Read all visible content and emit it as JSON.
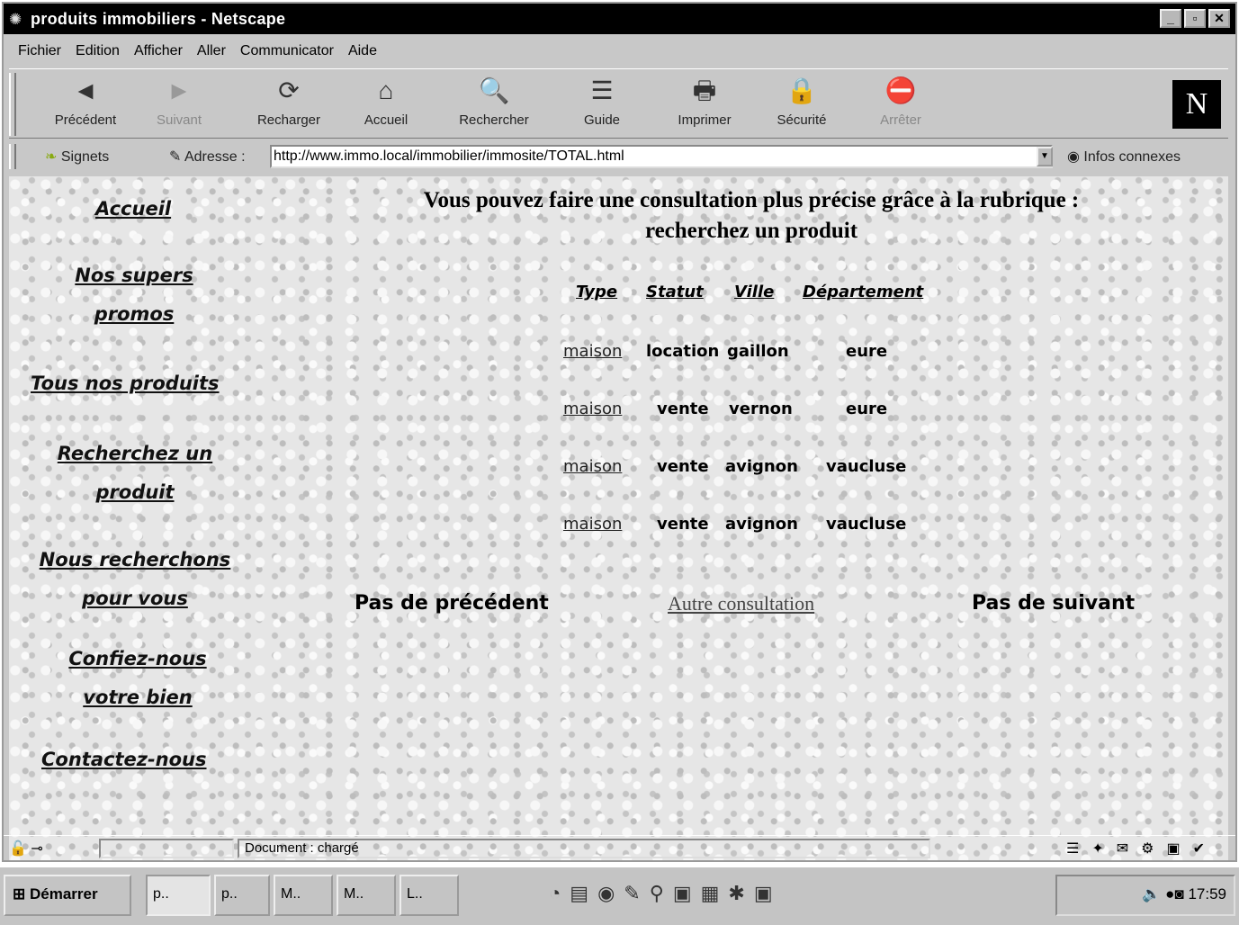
{
  "window": {
    "title": "produits immobiliers - Netscape",
    "controls": [
      "_",
      "▫",
      "✕"
    ]
  },
  "menu": [
    "Fichier",
    "Edition",
    "Afficher",
    "Aller",
    "Communicator",
    "Aide"
  ],
  "toolbar": {
    "buttons": [
      {
        "label": "Précédent",
        "icon": "back-icon",
        "glyph": "◄",
        "enabled": true
      },
      {
        "label": "Suivant",
        "icon": "forward-icon",
        "glyph": "►",
        "enabled": false
      },
      {
        "label": "Recharger",
        "icon": "reload-icon",
        "glyph": "⟳",
        "enabled": true
      },
      {
        "label": "Accueil",
        "icon": "home-icon",
        "glyph": "⌂",
        "enabled": true
      },
      {
        "label": "Rechercher",
        "icon": "search-icon",
        "glyph": "🔍",
        "enabled": true
      },
      {
        "label": "Guide",
        "icon": "guide-icon",
        "glyph": "☰",
        "enabled": true
      },
      {
        "label": "Imprimer",
        "icon": "print-icon",
        "glyph": "🖶",
        "enabled": true
      },
      {
        "label": "Sécurité",
        "icon": "lock-icon",
        "glyph": "🔒",
        "enabled": true
      },
      {
        "label": "Arrêter",
        "icon": "stop-icon",
        "glyph": "⛔",
        "enabled": false
      }
    ],
    "logo": "N"
  },
  "location": {
    "bookmarks_label": "Signets",
    "address_label": "Adresse :",
    "url": "http://www.immo.local/immobilier/immosite/TOTAL.html",
    "related_label": "Infos connexes"
  },
  "nav": {
    "accueil": "Accueil",
    "promos_1": "Nos supers",
    "promos_2": "promos",
    "produits": "Tous nos produits",
    "recherche_1": "Recherchez un",
    "recherche_2": "produit",
    "nous_1": "Nous recherchons",
    "nous_2": "pour vous",
    "confiez_1": "Confiez-nous",
    "confiez_2": "votre bien",
    "contact": "Contactez-nous"
  },
  "main": {
    "headline_1": "Vous pouvez faire une consultation plus précise grâce à la rubrique :",
    "headline_2": "recherchez un produit",
    "columns": [
      "Type",
      "Statut",
      "Ville",
      "Département"
    ],
    "rows": [
      [
        "maison",
        "location",
        "gaillon",
        "eure"
      ],
      [
        "maison",
        "vente",
        "vernon",
        "eure"
      ],
      [
        "maison",
        "vente",
        "avignon",
        "vaucluse"
      ],
      [
        "maison",
        "vente",
        "avignon",
        "vaucluse"
      ]
    ],
    "prev": "Pas de précédent",
    "other": "Autre consultation",
    "next": "Pas de suivant"
  },
  "status": {
    "text": "Document : chargé"
  },
  "taskbar": {
    "start": "Démarrer",
    "tasks": [
      "p..",
      "p..",
      "M..",
      "M..",
      "L.."
    ],
    "clock": "17:59"
  }
}
